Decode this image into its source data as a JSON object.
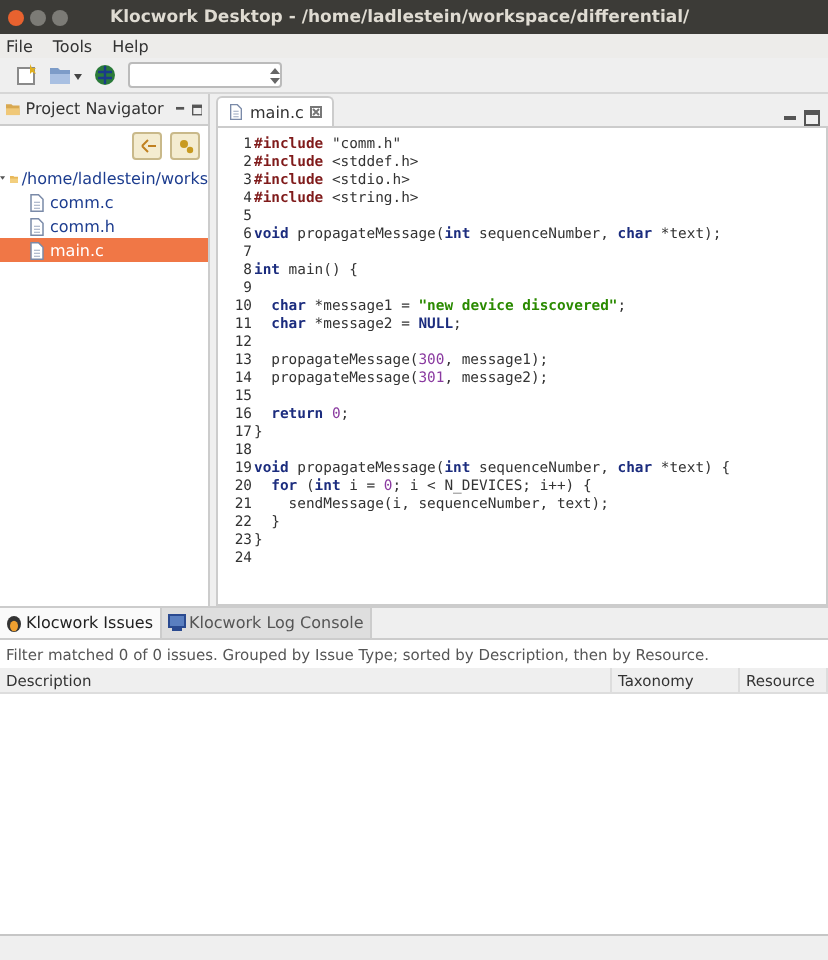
{
  "window": {
    "title": "Klocwork Desktop - /home/ladlestein/workspace/differential/"
  },
  "menu": [
    "File",
    "Tools",
    "Help"
  ],
  "navigator": {
    "title": "Project Navigator",
    "tree": [
      {
        "label": "/home/ladlestein/works",
        "expanded": true,
        "selected": false,
        "children": [
          {
            "label": "comm.c",
            "selected": false
          },
          {
            "label": "comm.h",
            "selected": false
          },
          {
            "label": "main.c",
            "selected": true
          }
        ]
      }
    ]
  },
  "editor": {
    "tabs": [
      {
        "label": "main.c",
        "selected": true
      }
    ],
    "lines": [
      {
        "number": "1",
        "tokens": [
          {
            "kind": "pp",
            "text": "#include"
          },
          {
            "kind": "plain",
            "text": " \"comm.h\""
          }
        ]
      },
      {
        "number": "2",
        "tokens": [
          {
            "kind": "pp",
            "text": "#include"
          },
          {
            "kind": "plain",
            "text": " <stddef.h>"
          }
        ]
      },
      {
        "number": "3",
        "tokens": [
          {
            "kind": "pp",
            "text": "#include"
          },
          {
            "kind": "plain",
            "text": " <stdio.h>"
          }
        ]
      },
      {
        "number": "4",
        "tokens": [
          {
            "kind": "pp",
            "text": "#include"
          },
          {
            "kind": "plain",
            "text": " <string.h>"
          }
        ]
      },
      {
        "number": "5"
      },
      {
        "number": "6",
        "tokens": [
          {
            "kind": "kw",
            "text": "void"
          },
          {
            "kind": "plain",
            "text": " propagateMessage("
          },
          {
            "kind": "kw",
            "text": "int"
          },
          {
            "kind": "plain",
            "text": " sequenceNumber, "
          },
          {
            "kind": "kw",
            "text": "char"
          },
          {
            "kind": "plain",
            "text": " *text);"
          }
        ]
      },
      {
        "number": "7"
      },
      {
        "number": "8",
        "tokens": [
          {
            "kind": "kw",
            "text": "int"
          },
          {
            "kind": "plain",
            "text": " main() {"
          }
        ]
      },
      {
        "number": "9"
      },
      {
        "number": "10",
        "tokens": [
          {
            "kind": "kw",
            "text": "  char"
          },
          {
            "kind": "plain",
            "text": " *message1 = "
          },
          {
            "kind": "str",
            "text": "\"new device discovered\""
          },
          {
            "kind": "plain",
            "text": ";"
          }
        ]
      },
      {
        "number": "11",
        "tokens": [
          {
            "kind": "kw",
            "text": "  char"
          },
          {
            "kind": "plain",
            "text": " *message2 = "
          },
          {
            "kind": "kw",
            "text": "NULL"
          },
          {
            "kind": "plain",
            "text": ";"
          }
        ]
      },
      {
        "number": "12"
      },
      {
        "number": "13",
        "tokens": [
          {
            "kind": "plain",
            "text": "  propagateMessage("
          },
          {
            "kind": "num",
            "text": "300"
          },
          {
            "kind": "plain",
            "text": ", message1);"
          }
        ]
      },
      {
        "number": "14",
        "tokens": [
          {
            "kind": "plain",
            "text": "  propagateMessage("
          },
          {
            "kind": "num",
            "text": "301"
          },
          {
            "kind": "plain",
            "text": ", message2);"
          }
        ]
      },
      {
        "number": "15"
      },
      {
        "number": "16",
        "tokens": [
          {
            "kind": "kw",
            "text": "  return "
          },
          {
            "kind": "num",
            "text": "0"
          },
          {
            "kind": "plain",
            "text": ";"
          }
        ]
      },
      {
        "number": "17",
        "tokens": [
          {
            "kind": "plain",
            "text": "}"
          }
        ]
      },
      {
        "number": "18"
      },
      {
        "number": "19",
        "tokens": [
          {
            "kind": "kw",
            "text": "void"
          },
          {
            "kind": "plain",
            "text": " propagateMessage("
          },
          {
            "kind": "kw",
            "text": "int"
          },
          {
            "kind": "plain",
            "text": " sequenceNumber, "
          },
          {
            "kind": "kw",
            "text": "char"
          },
          {
            "kind": "plain",
            "text": " *text) {"
          }
        ]
      },
      {
        "number": "20",
        "tokens": [
          {
            "kind": "kw",
            "text": "  for"
          },
          {
            "kind": "plain",
            "text": " ("
          },
          {
            "kind": "kw",
            "text": "int"
          },
          {
            "kind": "plain",
            "text": " i = "
          },
          {
            "kind": "num",
            "text": "0"
          },
          {
            "kind": "plain",
            "text": "; i < N_DEVICES; i++) {"
          }
        ]
      },
      {
        "number": "21",
        "tokens": [
          {
            "kind": "plain",
            "text": "    sendMessage(i, sequenceNumber, text);"
          }
        ]
      },
      {
        "number": "22",
        "tokens": [
          {
            "kind": "plain",
            "text": "  }"
          }
        ]
      },
      {
        "number": "23",
        "tokens": [
          {
            "kind": "plain",
            "text": "}"
          }
        ]
      },
      {
        "number": "24"
      }
    ]
  },
  "issues_panel": {
    "tabs": [
      {
        "label": "Klocwork Issues",
        "kind": "issues",
        "selected": true
      },
      {
        "label": "Klocwork Log Console",
        "kind": "console",
        "selected": false
      }
    ],
    "filter_text": "Filter matched 0 of 0 issues. Grouped by Issue Type; sorted by Description, then by Resource.",
    "columns": [
      "Description",
      "Taxonomy",
      "Resource"
    ]
  }
}
